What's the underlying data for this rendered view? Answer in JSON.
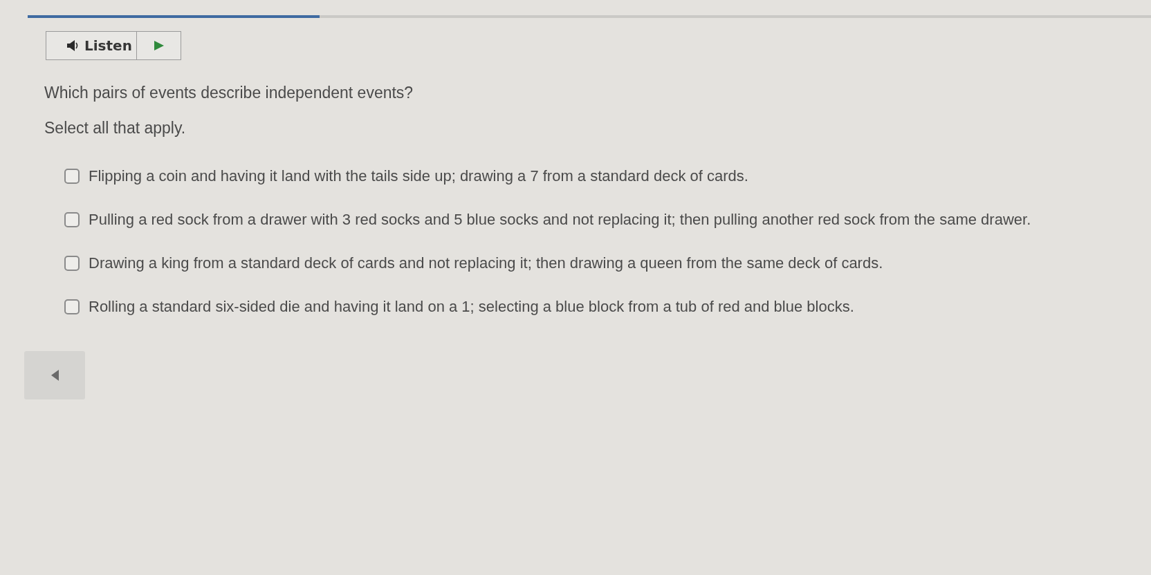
{
  "progress": {
    "level": 0.26
  },
  "listen": {
    "label": "Listen"
  },
  "question": "Which pairs of events describe independent events?",
  "instruction": "Select all that apply.",
  "options": [
    {
      "text": "Flipping a coin and having it land with the tails side up; drawing a 7 from a standard deck of cards.",
      "checked": false
    },
    {
      "text": "Pulling a red sock from a drawer with 3 red socks and 5 blue socks and not replacing it; then pulling another red sock from the same drawer.",
      "checked": false
    },
    {
      "text": "Drawing a king from a standard deck of cards and not replacing it; then drawing a queen from the same deck of cards.",
      "checked": false
    },
    {
      "text": "Rolling a standard six-sided die and having it land on a 1; selecting a blue block from a tub of red and blue blocks.",
      "checked": false
    }
  ]
}
